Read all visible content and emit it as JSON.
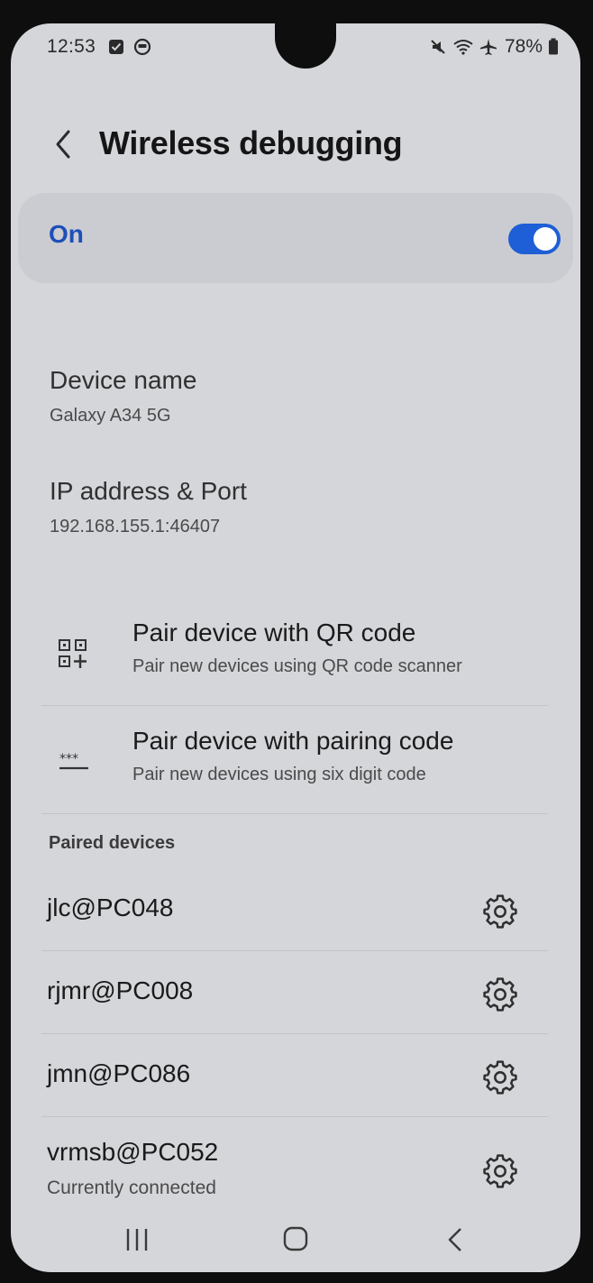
{
  "status_bar": {
    "time": "12:53",
    "battery_percent": "78%",
    "left_icons": [
      "checkbox-notification-icon",
      "sync-circle-icon"
    ],
    "right_icons": [
      "mute-icon",
      "wifi-icon",
      "airplane-icon",
      "battery-icon"
    ]
  },
  "header": {
    "title": "Wireless debugging"
  },
  "master_switch": {
    "label": "On",
    "enabled": true,
    "accent_color": "#1e5ed6"
  },
  "info": {
    "device_name": {
      "title": "Device name",
      "value": "Galaxy A34 5G"
    },
    "ip_port": {
      "title": "IP address & Port",
      "value": "192.168.155.1:46407"
    }
  },
  "pairing": {
    "qr": {
      "title": "Pair device with QR code",
      "subtitle": "Pair new devices using QR code scanner"
    },
    "code": {
      "title": "Pair device with pairing code",
      "subtitle": "Pair new devices using six digit code"
    }
  },
  "paired_devices": {
    "header": "Paired devices",
    "items": [
      {
        "name": "jlc@PC048"
      },
      {
        "name": "rjmr@PC008"
      },
      {
        "name": "jmn@PC086"
      },
      {
        "name": "vrmsb@PC052",
        "status": "Currently connected"
      }
    ]
  },
  "nav": {
    "icons": [
      "recent-apps-icon",
      "home-icon",
      "back-icon"
    ]
  }
}
